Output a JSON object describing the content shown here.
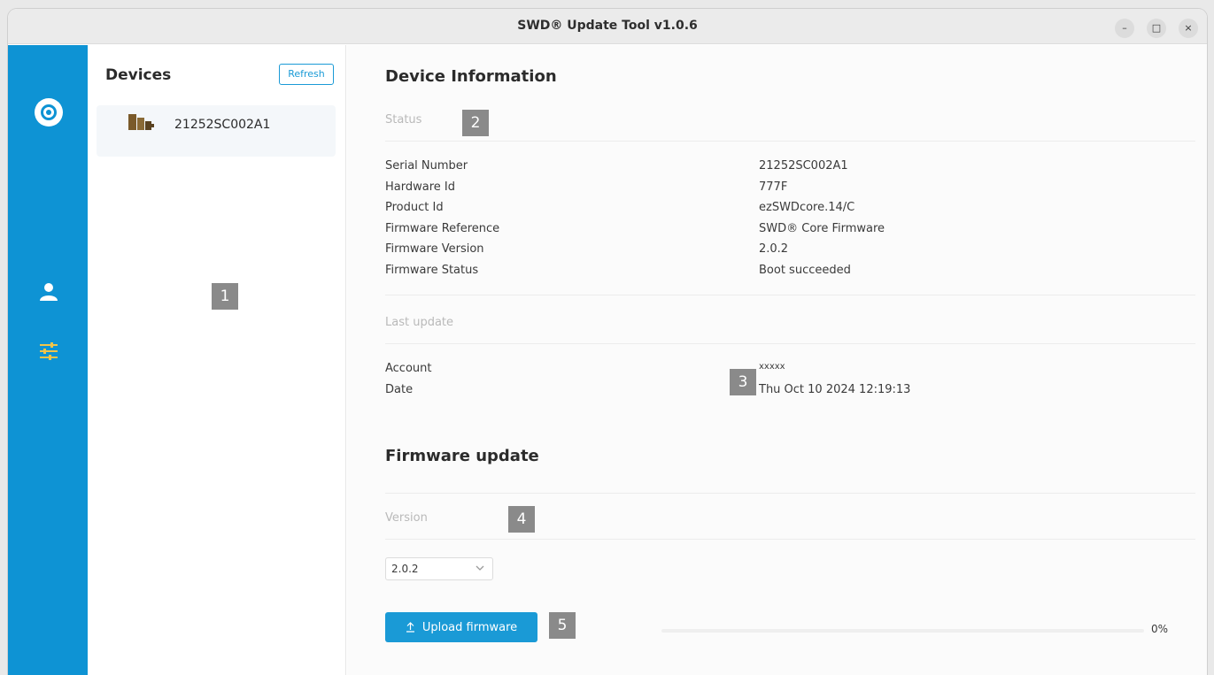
{
  "window": {
    "title": "SWD® Update Tool v1.0.6",
    "controls": {
      "minimize": "–",
      "maximize": "□",
      "close": "×"
    }
  },
  "rail": {
    "items": [
      {
        "icon": "app-logo-icon"
      },
      {
        "icon": "user-icon"
      },
      {
        "icon": "settings-sliders-icon",
        "active": true
      }
    ],
    "colors": {
      "background": "#0e93d4",
      "active_icon": "#f2c44a"
    }
  },
  "devices": {
    "title": "Devices",
    "refresh_label": "Refresh",
    "items": [
      {
        "label": "21252SC002A1",
        "icon": "device-chip-icon"
      }
    ]
  },
  "device_info": {
    "title": "Device Information",
    "status_label": "Status",
    "rows": [
      {
        "key": "Serial Number",
        "value": "21252SC002A1"
      },
      {
        "key": "Hardware Id",
        "value": "777F"
      },
      {
        "key": "Product Id",
        "value": "ezSWDcore.14/C"
      },
      {
        "key": "Firmware Reference",
        "value": "SWD® Core Firmware"
      },
      {
        "key": "Firmware Version",
        "value": "2.0.2"
      },
      {
        "key": "Firmware Status",
        "value": "Boot succeeded"
      }
    ],
    "last_update_label": "Last update",
    "last_update_rows": [
      {
        "key": "Account",
        "value": "xxxxx"
      },
      {
        "key": "Date",
        "value": "Thu Oct 10 2024 12:19:13"
      }
    ]
  },
  "firmware_update": {
    "title": "Firmware update",
    "version_label": "Version",
    "version_selected": "2.0.2",
    "upload_label": "Upload firmware",
    "progress_value": 0,
    "progress_text": "0%"
  },
  "annotations": [
    "1",
    "2",
    "3",
    "4",
    "5"
  ],
  "colors": {
    "accent": "#1a9ad6",
    "badge": "#8a8a8a"
  }
}
